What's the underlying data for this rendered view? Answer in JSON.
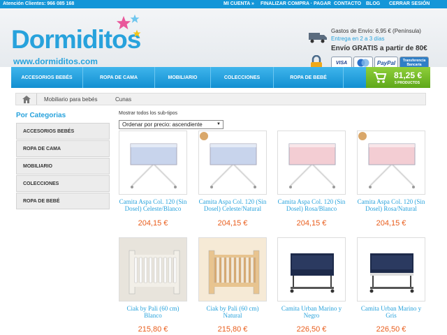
{
  "topbar": {
    "phone": "Atención Clientes: 966 085 168",
    "links": [
      "MI CUENTA »",
      "FINALIZAR COMPRA · PAGAR",
      "CONTACTO",
      "BLOG",
      "CERRAR SESIÓN"
    ]
  },
  "header": {
    "logo": "Dormiditos",
    "url": "www.dormiditos.com",
    "shipping_cost": "Gastos de Envío:  6,95 € (Península)",
    "delivery": "Entrega en 2 a 3 días",
    "free_shipping": "Envío GRATIS a partir de 80€",
    "payments": [
      "VISA",
      "MC",
      "PayPal",
      "Transferencia Bancaria"
    ]
  },
  "nav": {
    "items": [
      "ACCESORIOS BEBÉS",
      "ROPA DE CAMA",
      "MOBILIARIO",
      "COLECCIONES",
      "ROPA DE BEBÉ"
    ],
    "cart_amount": "81,25 €",
    "cart_items": "5 PRODUCTOS"
  },
  "breadcrumb": {
    "items": [
      "Mobiliario para bebés",
      "Cunas"
    ]
  },
  "sidebar": {
    "title": "Por Categorias",
    "items": [
      "ACCESORIOS BEBÉS",
      "ROPA DE CAMA",
      "MOBILIARIO",
      "COLECCIONES",
      "ROPA DE BEBÉ"
    ]
  },
  "listing": {
    "show_all": "Mostrar todos los sub-tipos",
    "sort_value": "Ordenar por precio: ascendiente"
  },
  "products": [
    {
      "name": "Camita Aspa Col. 120 (Sin Dosel) Celeste/Blanco",
      "price": "204,15 €",
      "color": "#c8d4ec"
    },
    {
      "name": "Camita Aspa Col. 120 (Sin Dosel) Celeste/Natural",
      "price": "204,15 €",
      "color": "#c8d4ec"
    },
    {
      "name": "Camita Aspa Col. 120 (Sin Dosel) Rosa/Blanco",
      "price": "204,15 €",
      "color": "#f3cdd3"
    },
    {
      "name": "Camita Aspa Col. 120 (Sin Dosel) Rosa/Natural",
      "price": "204,15 €",
      "color": "#f3cdd3"
    },
    {
      "name": "Ciak by Pali (60 cm) Blanco",
      "price": "215,80 €",
      "color": "#f2efe8"
    },
    {
      "name": "Ciak by Pali (60 cm) Natural",
      "price": "215,80 €",
      "color": "#e8c48f"
    },
    {
      "name": "Camita Urban Marino y Negro",
      "price": "226,50 €",
      "color": "#1d2a4a"
    },
    {
      "name": "Camita Urban Marino y Gris",
      "price": "226,50 €",
      "color": "#1d2a4a"
    }
  ],
  "colors": {
    "primary": "#1496d8",
    "cart": "#6cb624",
    "price": "#e95d1c",
    "link": "#27a2dc"
  }
}
